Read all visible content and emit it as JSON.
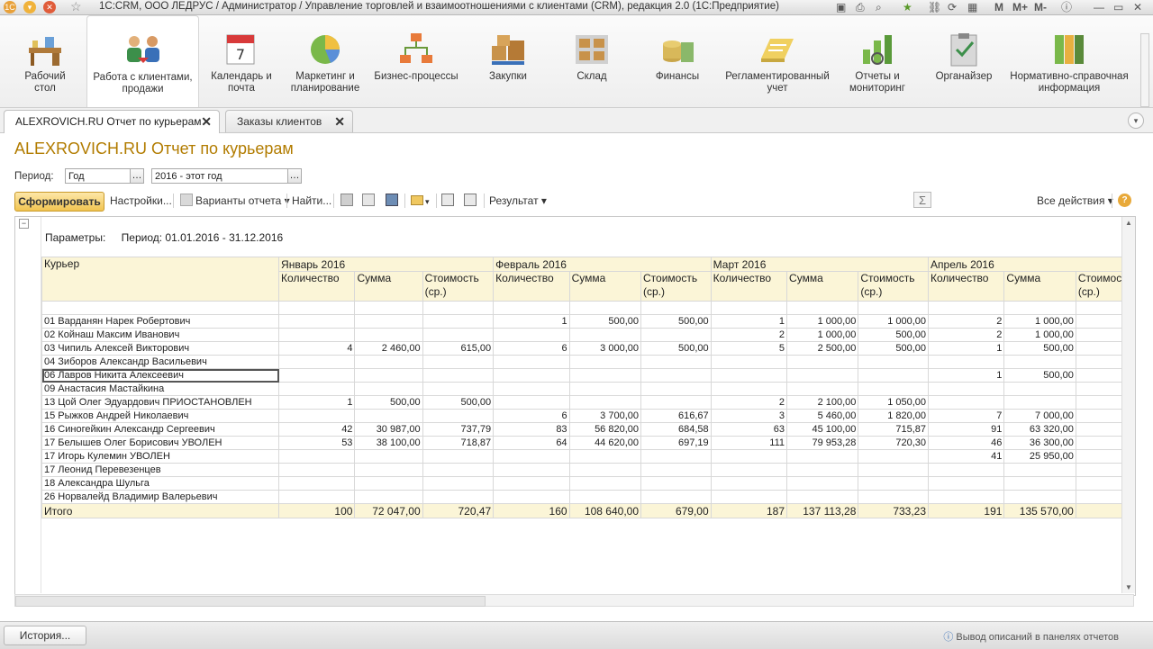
{
  "window": {
    "title": "1С:CRM, ООО ЛЕДРУС / Администратор / Управление торговлей и взаимоотношениями с клиентами (CRM), редакция 2.0  (1С:Предприятие)",
    "right_controls": [
      "M",
      "M+",
      "M-"
    ]
  },
  "sections": [
    {
      "label": "Рабочий стол",
      "icon": "desk-icon"
    },
    {
      "label": "Работа с клиентами, продажи",
      "icon": "clients-icon",
      "active": true
    },
    {
      "label": "Календарь и почта",
      "icon": "calendar-icon"
    },
    {
      "label": "Маркетинг и планирование",
      "icon": "pie-chart-icon"
    },
    {
      "label": "Бизнес-процессы",
      "icon": "process-icon"
    },
    {
      "label": "Закупки",
      "icon": "boxes-icon"
    },
    {
      "label": "Склад",
      "icon": "warehouse-icon"
    },
    {
      "label": "Финансы",
      "icon": "coins-icon"
    },
    {
      "label": "Регламентированный учет",
      "icon": "ledger-icon"
    },
    {
      "label": "Отчеты и мониторинг",
      "icon": "report-icon"
    },
    {
      "label": "Органайзер",
      "icon": "clipboard-icon"
    },
    {
      "label": "Нормативно-справочная информация",
      "icon": "binders-icon"
    }
  ],
  "tabs": [
    {
      "label": "ALEXROVICH.RU Отчет по курьерам",
      "active": true
    },
    {
      "label": "Заказы клиентов",
      "active": false
    }
  ],
  "report": {
    "title": "ALEXROVICH.RU Отчет по курьерам",
    "period_label": "Период:",
    "period_type": "Год",
    "period_value": "2016 - этот год",
    "params_label": "Параметры:",
    "params_value": "Период: 01.01.2016 - 31.12.2016"
  },
  "toolbar": {
    "form_button": "Сформировать",
    "settings": "Настройки...",
    "variants": "Варианты отчета",
    "find": "Найти...",
    "result": "Результат",
    "all_actions": "Все действия"
  },
  "table": {
    "header_courier": "Курьер",
    "months": [
      "Январь 2016",
      "Февраль 2016",
      "Март 2016",
      "Апрель 2016"
    ],
    "sub_headers": [
      "Количество",
      "Сумма",
      "Стоимость (ср.)"
    ],
    "rows": [
      {
        "name": "01 Варданян Нарек Робертович",
        "v": [
          "",
          "",
          "",
          "1",
          "500,00",
          "500,00",
          "1",
          "1 000,00",
          "1 000,00",
          "2",
          "1 000,00"
        ]
      },
      {
        "name": "02 Койнаш Максим Иванович",
        "v": [
          "",
          "",
          "",
          "",
          "",
          "",
          "2",
          "1 000,00",
          "500,00",
          "2",
          "1 000,00"
        ]
      },
      {
        "name": "03 Чипиль Алексей Викторович",
        "v": [
          "4",
          "2 460,00",
          "615,00",
          "6",
          "3 000,00",
          "500,00",
          "5",
          "2 500,00",
          "500,00",
          "1",
          "500,00"
        ]
      },
      {
        "name": "04 Зиборов Александр Васильевич",
        "v": [
          "",
          "",
          "",
          "",
          "",
          "",
          "",
          "",
          "",
          "",
          ""
        ]
      },
      {
        "name": "06 Лавров Никита Алексеевич",
        "v": [
          "",
          "",
          "",
          "",
          "",
          "",
          "",
          "",
          "",
          "1",
          "500,00"
        ],
        "selected": true
      },
      {
        "name": "09 Анастасия Мастайкина",
        "v": [
          "",
          "",
          "",
          "",
          "",
          "",
          "",
          "",
          "",
          "",
          ""
        ]
      },
      {
        "name": "13 Цой Олег Эдуардович ПРИОСТАНОВЛЕН",
        "v": [
          "1",
          "500,00",
          "500,00",
          "",
          "",
          "",
          "2",
          "2 100,00",
          "1 050,00",
          "",
          ""
        ]
      },
      {
        "name": "15 Рыжков Андрей Николаевич",
        "v": [
          "",
          "",
          "",
          "6",
          "3 700,00",
          "616,67",
          "3",
          "5 460,00",
          "1 820,00",
          "7",
          "7 000,00"
        ]
      },
      {
        "name": "16 Синогейкин Александр Сергеевич",
        "v": [
          "42",
          "30 987,00",
          "737,79",
          "83",
          "56 820,00",
          "684,58",
          "63",
          "45 100,00",
          "715,87",
          "91",
          "63 320,00"
        ]
      },
      {
        "name": "17 Белышев Олег Борисович УВОЛЕН",
        "v": [
          "53",
          "38 100,00",
          "718,87",
          "64",
          "44 620,00",
          "697,19",
          "111",
          "79 953,28",
          "720,30",
          "46",
          "36 300,00"
        ]
      },
      {
        "name": "17 Игорь Кулемин УВОЛЕН",
        "v": [
          "",
          "",
          "",
          "",
          "",
          "",
          "",
          "",
          "",
          "41",
          "25 950,00"
        ]
      },
      {
        "name": "17 Леонид Перевезенцев",
        "v": [
          "",
          "",
          "",
          "",
          "",
          "",
          "",
          "",
          "",
          "",
          ""
        ]
      },
      {
        "name": "18 Александра Шульга",
        "v": [
          "",
          "",
          "",
          "",
          "",
          "",
          "",
          "",
          "",
          "",
          ""
        ]
      },
      {
        "name": "26 Норвалейд Владимир Валерьевич",
        "v": [
          "",
          "",
          "",
          "",
          "",
          "",
          "",
          "",
          "",
          "",
          ""
        ]
      }
    ],
    "total": {
      "name": "Итого",
      "v": [
        "100",
        "72 047,00",
        "720,47",
        "160",
        "108 640,00",
        "679,00",
        "187",
        "137 113,28",
        "733,23",
        "191",
        "135 570,00"
      ]
    }
  },
  "bottom": {
    "history": "История...",
    "hint": "Вывод описаний в панелях отчетов"
  }
}
